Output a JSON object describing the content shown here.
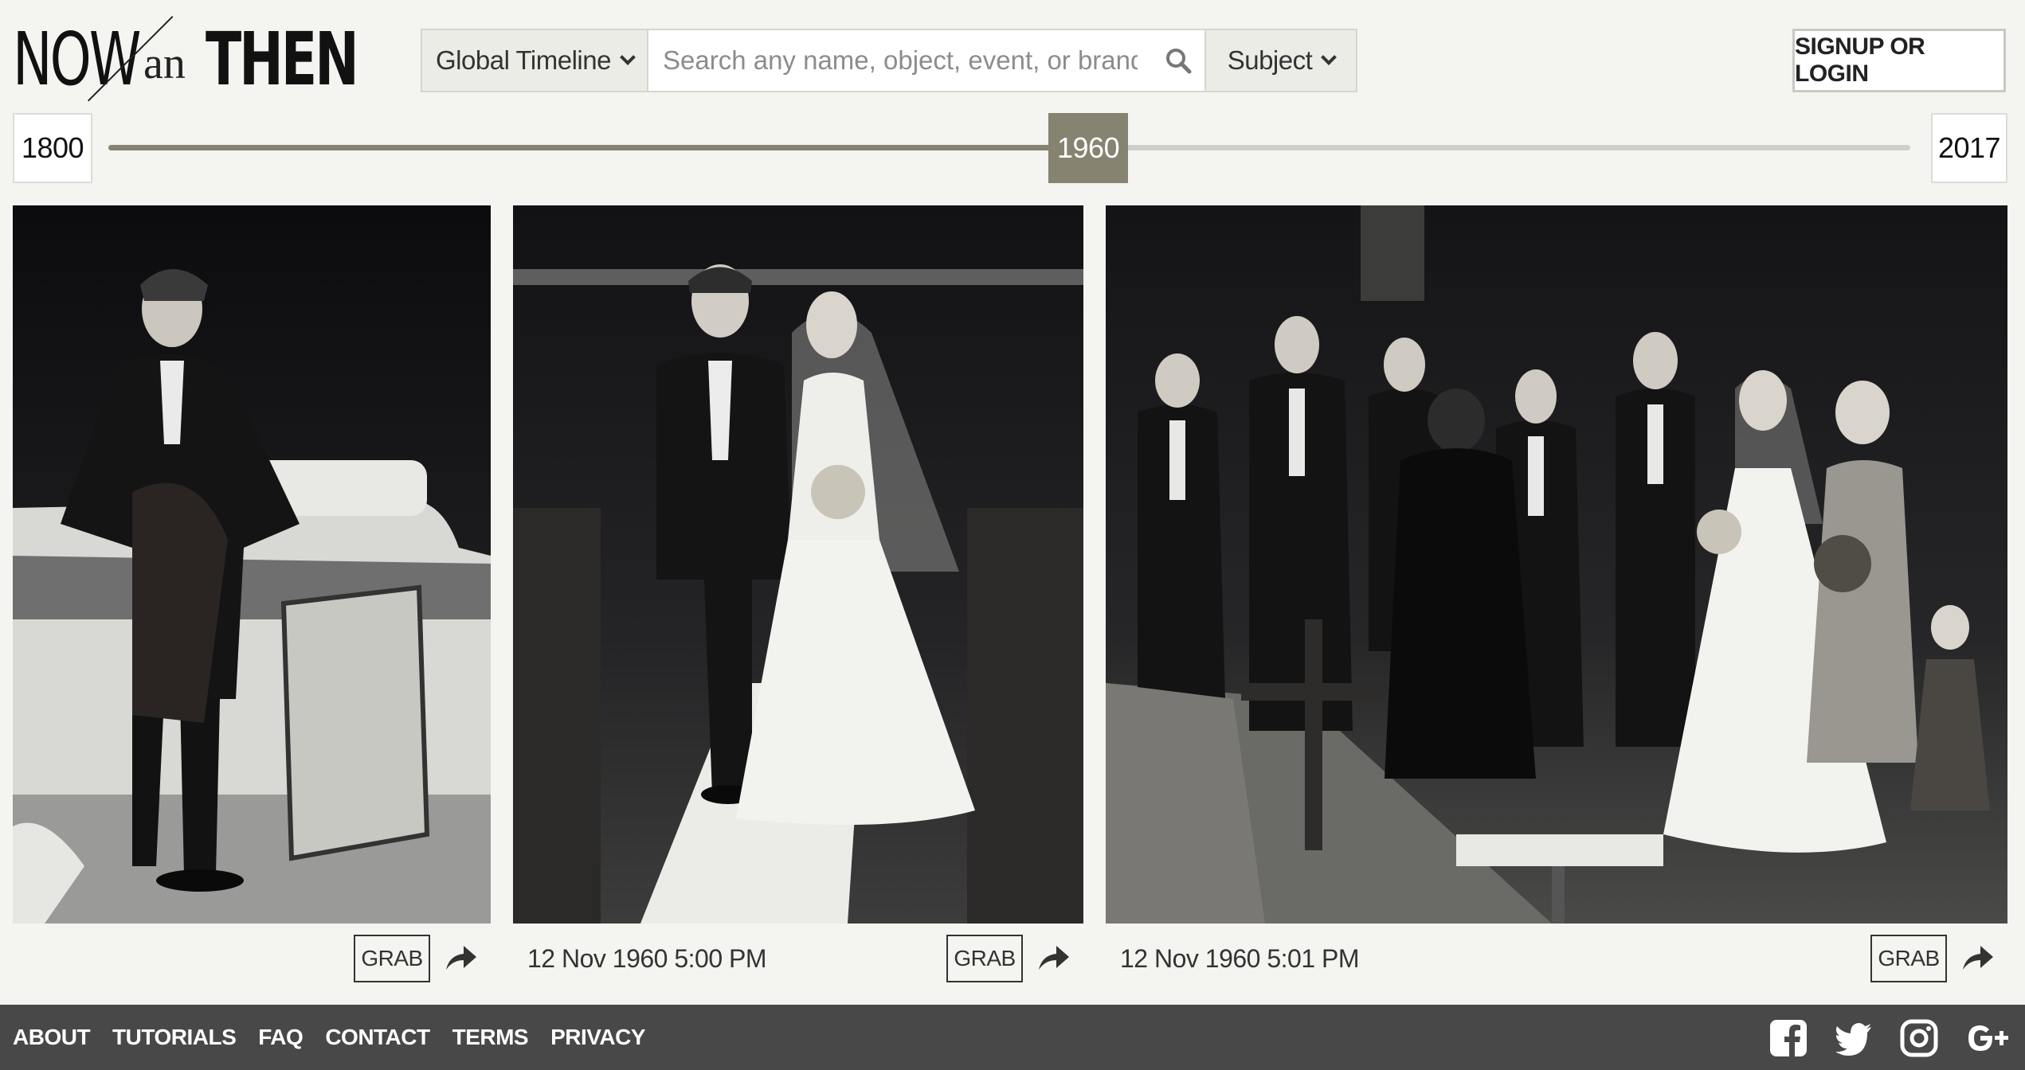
{
  "logo": {
    "now": "NOW",
    "an": "an",
    "then": "THEN"
  },
  "search": {
    "timeline_label": "Global Timeline",
    "placeholder": "Search any name, object, event, or brand",
    "subject_label": "Subject"
  },
  "auth": {
    "login_label": "SIGNUP OR LOGIN"
  },
  "timeline": {
    "start_year": "1800",
    "end_year": "2017",
    "current_year": "1960",
    "position": 0.5438
  },
  "photos": [
    {
      "date": "",
      "grab_label": "GRAB",
      "subject": "man in tuxedo at open car door"
    },
    {
      "date": "12 Nov 1960 5:00 PM",
      "grab_label": "GRAB",
      "subject": "bride and groom walking down aisle"
    },
    {
      "date": "12 Nov 1960 5:01 PM",
      "grab_label": "GRAB",
      "subject": "wedding party at altar with minister"
    }
  ],
  "footer": {
    "links": [
      "ABOUT",
      "TUTORIALS",
      "FAQ",
      "CONTACT",
      "TERMS",
      "PRIVACY"
    ],
    "social": [
      "facebook-icon",
      "twitter-icon",
      "instagram-icon",
      "google-plus-icon"
    ]
  },
  "colors": {
    "background": "#f4f4f1",
    "accent": "#868371",
    "footer": "#484848"
  }
}
